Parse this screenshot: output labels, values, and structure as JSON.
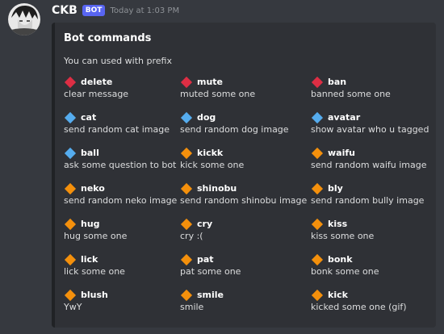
{
  "message": {
    "username": "CKB",
    "badge": "BOT",
    "timestamp": "Today at 1:03 PM"
  },
  "embed": {
    "title": "Bot commands",
    "description": "You can used with prefix",
    "fields": [
      {
        "name": "delete",
        "value": "clear message",
        "icon": "red-diamond-icon"
      },
      {
        "name": "mute",
        "value": "muted some one",
        "icon": "red-diamond-icon"
      },
      {
        "name": "ban",
        "value": "banned some one",
        "icon": "red-diamond-icon"
      },
      {
        "name": "cat",
        "value": "send random cat image",
        "icon": "blue-diamond-icon"
      },
      {
        "name": "dog",
        "value": "send random dog image",
        "icon": "blue-diamond-icon"
      },
      {
        "name": "avatar",
        "value": "show avatar who u tagged",
        "icon": "blue-diamond-icon"
      },
      {
        "name": "ball",
        "value": "ask some question to bot",
        "icon": "blue-diamond-icon"
      },
      {
        "name": "kickk",
        "value": "kick some one",
        "icon": "orange-diamond-icon"
      },
      {
        "name": "waifu",
        "value": "send random waifu image",
        "icon": "orange-diamond-icon"
      },
      {
        "name": "neko",
        "value": "send random neko image",
        "icon": "orange-diamond-icon"
      },
      {
        "name": "shinobu",
        "value": "send random shinobu image",
        "icon": "orange-diamond-icon"
      },
      {
        "name": "bly",
        "value": "send random bully image",
        "icon": "orange-diamond-icon"
      },
      {
        "name": "hug",
        "value": "hug some one",
        "icon": "orange-diamond-icon"
      },
      {
        "name": "cry",
        "value": "cry :(",
        "icon": "orange-diamond-icon"
      },
      {
        "name": "kiss",
        "value": "kiss some one",
        "icon": "orange-diamond-icon"
      },
      {
        "name": "lick",
        "value": "lick some one",
        "icon": "orange-diamond-icon"
      },
      {
        "name": "pat",
        "value": "pat some one",
        "icon": "orange-diamond-icon"
      },
      {
        "name": "bonk",
        "value": "bonk some one",
        "icon": "orange-diamond-icon"
      },
      {
        "name": "blush",
        "value": "YwY",
        "icon": "orange-diamond-icon"
      },
      {
        "name": "smile",
        "value": "smile",
        "icon": "orange-diamond-icon"
      },
      {
        "name": "kick",
        "value": "kicked some one (gif)",
        "icon": "orange-diamond-icon"
      }
    ]
  },
  "colors": {
    "background": "#36393f",
    "embed_background": "#2f3136",
    "bot_badge": "#5865f2",
    "red_diamond": "#dd2e44",
    "blue_diamond": "#55acee",
    "orange_diamond": "#f4900c"
  }
}
